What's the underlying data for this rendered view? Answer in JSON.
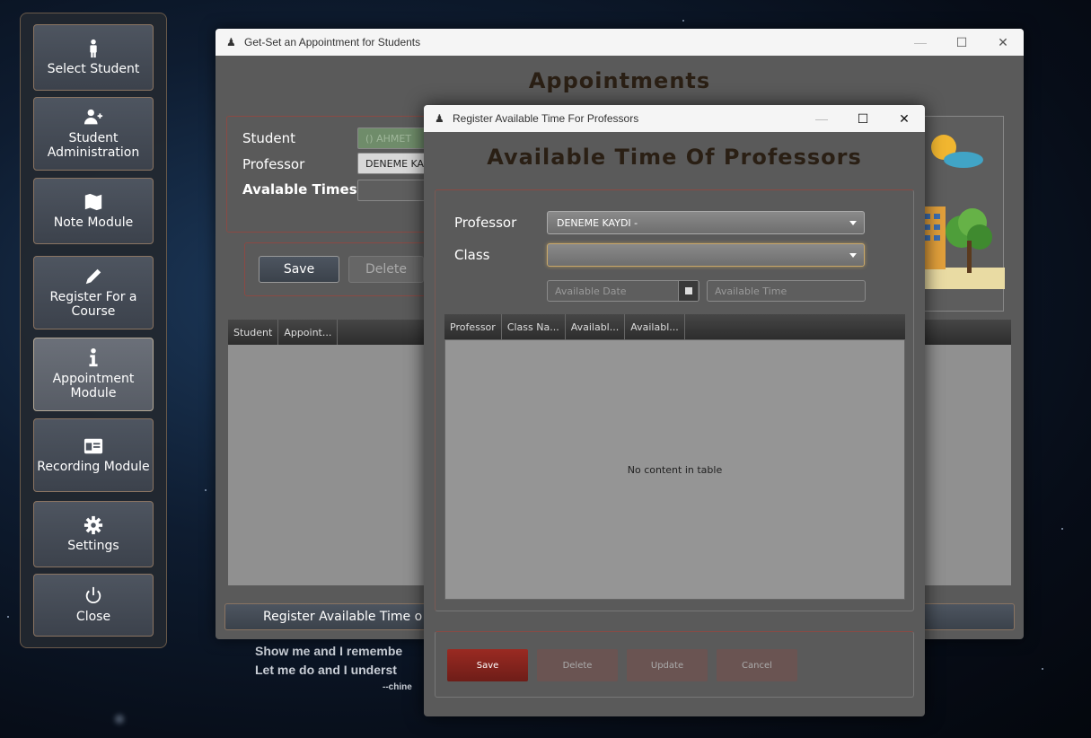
{
  "sidebar": {
    "items": [
      {
        "label": "Select Student"
      },
      {
        "label": "Student Administration"
      },
      {
        "label": "Note Module"
      },
      {
        "label": "Register For a Course"
      },
      {
        "label": "Appointment Module"
      },
      {
        "label": "Recording Module"
      },
      {
        "label": "Settings"
      },
      {
        "label": "Close"
      }
    ]
  },
  "quote": {
    "line1": "Show me and I remembe",
    "line2": "Let me do and I underst",
    "attribution": "--chine"
  },
  "appointments_window": {
    "title": "Get-Set an Appointment for Students",
    "heading": "Appointments",
    "labels": {
      "student": "Student",
      "professor": "Professor",
      "available_times": "Avalable Times"
    },
    "fields": {
      "student_value": "() AHMET",
      "professor_value": "DENEME KA",
      "available_times_value": ""
    },
    "save_label": "Save",
    "delete_label": "Delete",
    "table_columns": [
      "Student",
      "Appoint..."
    ],
    "register_button_label": "Register Available Time o"
  },
  "dialog": {
    "title": "Register Available Time For Professors",
    "heading": "Available Time Of Professors",
    "labels": {
      "professor": "Professor",
      "class": "Class"
    },
    "professor_value": "DENEME KAYDI -",
    "class_value": "",
    "date_placeholder": "Available Date",
    "time_placeholder": "Available Time",
    "table_columns": [
      "Professor",
      "Class Na...",
      "Availabl...",
      "Availabl..."
    ],
    "empty_text": "No content in table",
    "buttons": {
      "save": "Save",
      "delete": "Delete",
      "update": "Update",
      "cancel": "Cancel"
    }
  },
  "colors": {
    "accent_red": "#9a2a22",
    "heading_brown": "#2a1f14"
  }
}
